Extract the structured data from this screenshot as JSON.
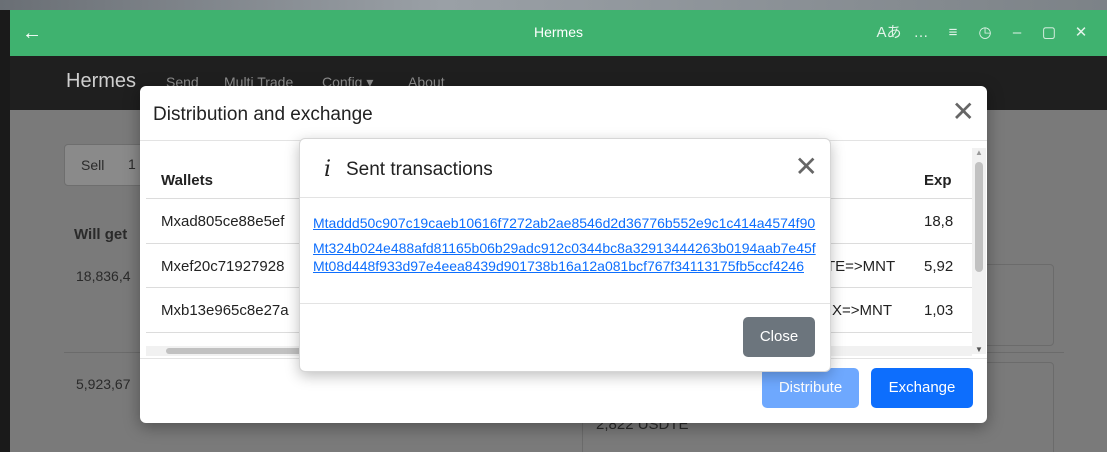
{
  "window": {
    "title": "Hermes",
    "back_glyph": "←",
    "controls": [
      "Aあ",
      "…",
      "≡",
      "◷",
      "–",
      "▢",
      "✕"
    ],
    "control_icons": [
      "translate-icon",
      "more-icon",
      "menu-icon",
      "timer-icon",
      "minimize-icon",
      "maximize-icon",
      "close-icon"
    ]
  },
  "app": {
    "brand": "Hermes",
    "nav": [
      "Send",
      "Multi Trade",
      "Config ▾",
      "About"
    ],
    "tab_label": "Sell",
    "tab_extra": "1",
    "will_get": "Will get",
    "amounts": [
      "18,836,4",
      "5,923,67"
    ],
    "usdte_fragment": "2,822 USDTE"
  },
  "distribution_dialog": {
    "title": "Distribution and exchange",
    "columns": {
      "wallets": "Wallets",
      "expected": "Exp"
    },
    "rows": [
      {
        "wallet": "Mxad805ce88e5ef",
        "pair": "",
        "expected": "18,8"
      },
      {
        "wallet": "Mxef20c71927928",
        "pair": "TE=>MNT",
        "expected": "5,92"
      },
      {
        "wallet": "Mxb13e965c8e27a",
        "pair": "X=>MNT",
        "expected": "1,03"
      }
    ],
    "buttons": {
      "distribute": "Distribute",
      "exchange": "Exchange"
    }
  },
  "sent_dialog": {
    "info_glyph": "i",
    "title": "Sent transactions",
    "transactions": [
      "Mtaddd50c907c19caeb10616f7272ab2ae8546d2d36776b552e9c1c414a4574f90",
      "Mt324b024e488afd81165b06b29adc912c0344bc8a32913444263b0194aab7e45f",
      "Mt08d448f933d97e4eea8439d901738b16a12a081bcf767f34113175fb5ccf4246"
    ],
    "close_label": "Close"
  },
  "colors": {
    "titlebar": "#3fb26f",
    "primary": "#0d6efd",
    "primary_disabled": "#6ea8fe",
    "secondary": "#6c757d",
    "link": "#0d6efd"
  }
}
